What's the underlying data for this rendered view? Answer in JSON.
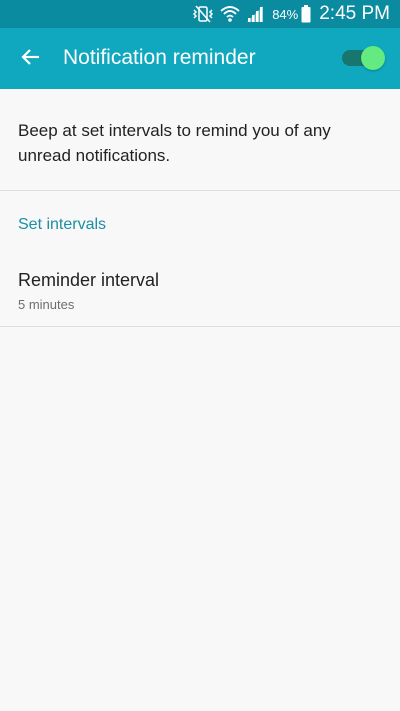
{
  "status_bar": {
    "battery_percent": "84%",
    "time": "2:45 PM",
    "icons": [
      "vibrate-mute-icon",
      "wifi-icon",
      "signal-icon",
      "battery-icon"
    ]
  },
  "app_bar": {
    "title": "Notification reminder",
    "back_icon": "arrow-left-icon",
    "toggle_on": true
  },
  "description": "Beep at set intervals to remind you of any unread notifications.",
  "sections": [
    {
      "header": "Set intervals",
      "items": [
        {
          "title": "Reminder interval",
          "summary": "5 minutes"
        }
      ]
    }
  ],
  "colors": {
    "status_bar": "#0a8ba0",
    "app_bar": "#0fa8bf",
    "accent": "#1b8fa5",
    "toggle_thumb": "#63ea81",
    "toggle_track": "#17776e"
  }
}
